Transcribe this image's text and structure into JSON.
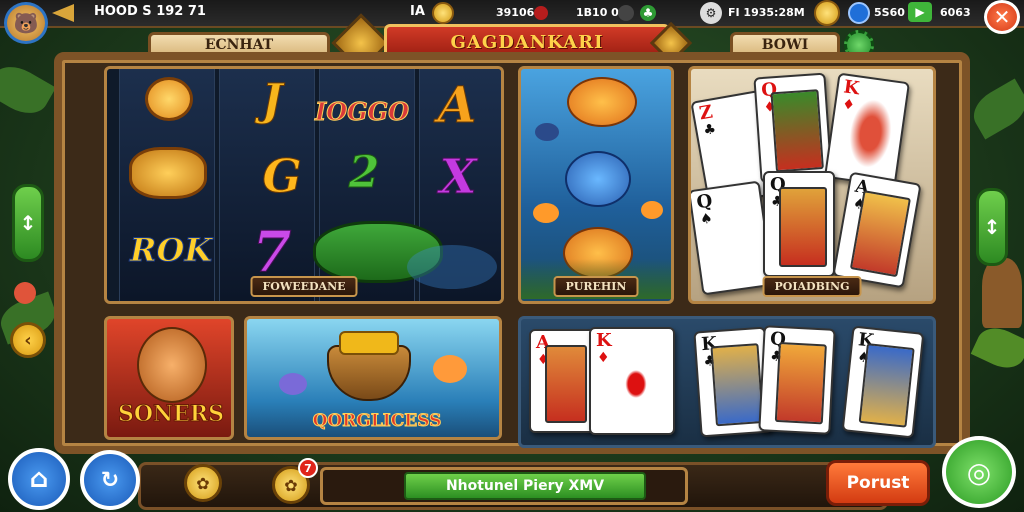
{
  "topbar": {
    "player_text": "HOOD S 192 71",
    "stat1": "IA",
    "stat2": "39106",
    "stat3": "1B10 0",
    "stat4": "FI 1935:28M",
    "stat5": "5S60",
    "stat6": "6063",
    "close_label": "✕"
  },
  "header": {
    "left_tab": "ECNHAT",
    "title": "GAGDANKARI",
    "right_tab": "BOWI"
  },
  "tiles": {
    "slots": {
      "caption": "FOWEEDANE",
      "symbols": [
        "J",
        "IOGGO",
        "A",
        "G",
        "2",
        "X",
        "ROK",
        "7"
      ]
    },
    "fish": {
      "caption": "PUREHIN"
    },
    "cards_top": {
      "caption": "POIADBING",
      "cards": [
        {
          "rank": "Z",
          "suit": "♣"
        },
        {
          "rank": "Q",
          "suit": "♦"
        },
        {
          "rank": "K",
          "suit": "♦"
        },
        {
          "rank": "Q",
          "suit": "♠"
        },
        {
          "rank": "Q",
          "suit": "♣"
        },
        {
          "rank": "A",
          "suit": "♠"
        }
      ]
    },
    "soners": {
      "label": "SONERS"
    },
    "fishing": {
      "label": "QORGLICESS"
    },
    "cards_bottom": {
      "cards": [
        {
          "rank": "A",
          "suit": "♦"
        },
        {
          "rank": "K",
          "suit": "♦"
        },
        {
          "rank": "K",
          "suit": "♣"
        },
        {
          "rank": "Q",
          "suit": "♣"
        },
        {
          "rank": "K",
          "suit": "♠"
        }
      ]
    }
  },
  "bottombar": {
    "badge_count": "7",
    "message": "Nhotunel Piery XMV",
    "post_button": "Porust"
  },
  "colors": {
    "accent_red": "#d13a26",
    "accent_green": "#2c8f22",
    "wood": "#7d5327"
  }
}
